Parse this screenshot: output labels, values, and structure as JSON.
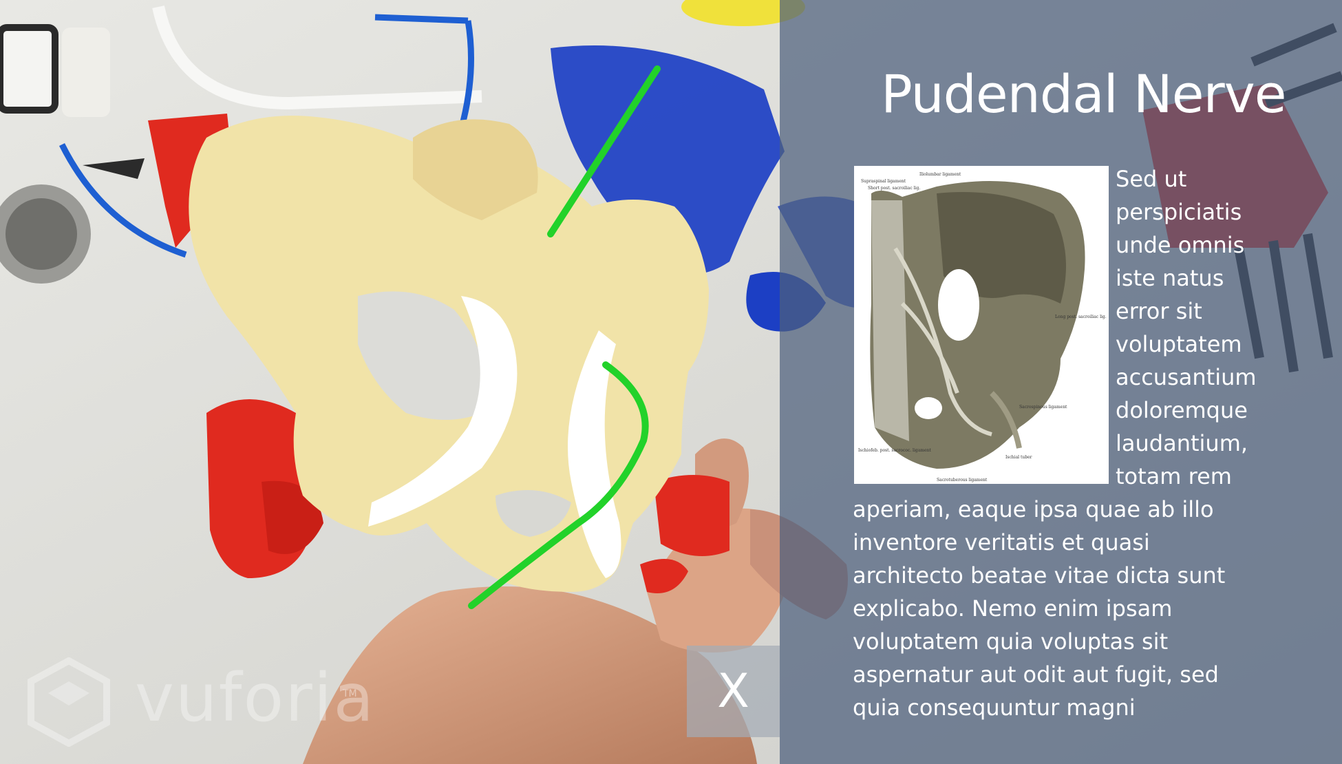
{
  "panel": {
    "title": "Pudendal Nerve",
    "body": "Sed ut perspiciatis unde omnis iste natus error sit voluptatem accusantium doloremque laudantium, totam rem aperiam, eaque ipsa quae ab illo inventore veritatis et quasi architecto beatae vitae dicta sunt explicabo. Nemo enim ipsam voluptatem quia voluptas sit aspernatur aut odit aut fugit, sed quia consequuntur magni"
  },
  "figure": {
    "labels": [
      "Supraspinal ligament",
      "Short post. sacroiliac lig.",
      "Iliolumbar ligament",
      "Long post. sacroiliac lig.",
      "Sacrospinous ligament",
      "Sacrotuberous ligament",
      "Ischiofeb. post. sacrococ. ligament",
      "Ischial tuber"
    ]
  },
  "close_button": {
    "label": "X"
  },
  "watermark": {
    "brand": "vuforia",
    "tm": "TM"
  },
  "colors": {
    "panel": "#4e5f7d",
    "bone": "#f1e3a8",
    "nerve": "#22d22a",
    "model_red": "#e02a1f",
    "mesh_blue": "#1c3fc4"
  }
}
